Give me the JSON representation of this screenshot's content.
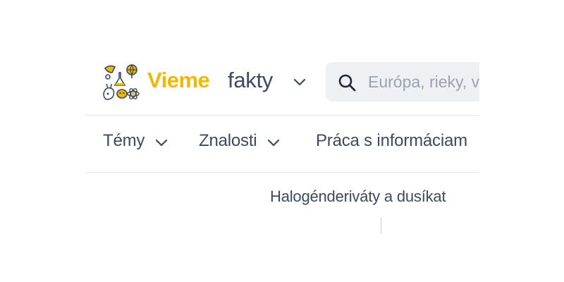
{
  "header": {
    "brand_primary": "Vieme",
    "brand_secondary": "fakty",
    "logo_icon": "science-doodle-logo-icon",
    "brand_chevron_icon": "chevron-down-icon"
  },
  "search": {
    "placeholder": "Európa, rieky, v",
    "icon": "search-icon"
  },
  "nav": {
    "items": [
      {
        "label": "Témy"
      },
      {
        "label": "Znalosti"
      },
      {
        "label": "Práca s informáciam"
      }
    ]
  },
  "main": {
    "title": "Halogénderiváty a dusíkat"
  },
  "colors": {
    "brand_yellow": "#f2b705",
    "text_dark": "#3b4a5e",
    "search_bg": "#eef0f3",
    "placeholder": "#9aa3b0",
    "divider": "#e6e8ec"
  }
}
